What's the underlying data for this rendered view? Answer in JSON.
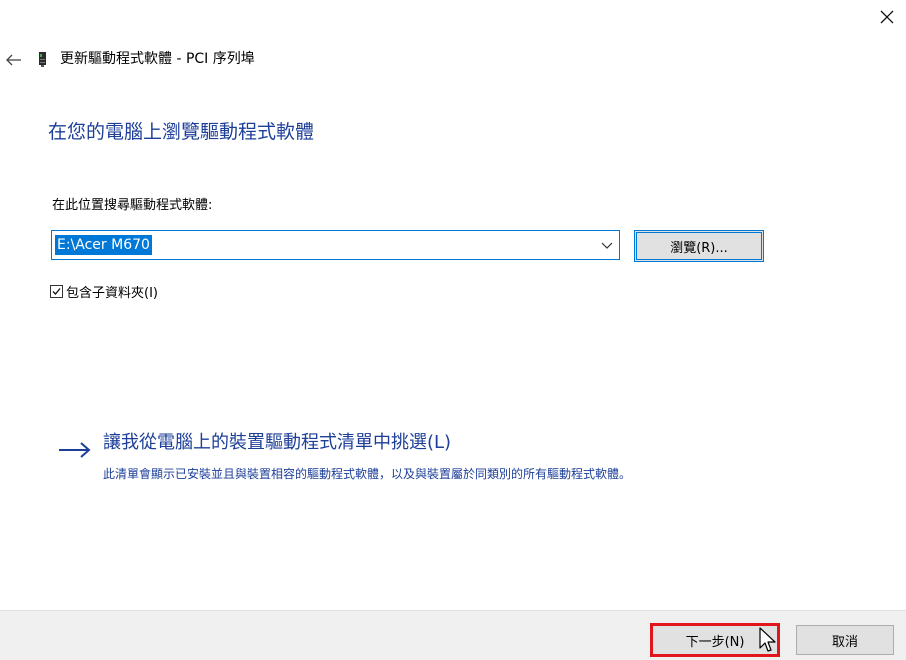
{
  "window": {
    "close_icon": "close-icon",
    "back_icon": "back-arrow-icon"
  },
  "header": {
    "device_icon": "pci-device-icon",
    "title": "更新驅動程式軟體 - PCI 序列埠"
  },
  "main": {
    "heading": "在您的電腦上瀏覽驅動程式軟體",
    "search_label": "在此位置搜尋驅動程式軟體:",
    "path_value": "E:\\Acer M670",
    "browse_label": "瀏覽(R)...",
    "include_subfolders_label": "包含子資料夾(I)",
    "include_subfolders_checked": true
  },
  "pick_option": {
    "arrow_icon": "right-arrow-icon",
    "link": "讓我從電腦上的裝置驅動程式清單中挑選(L)",
    "description": "此清單會顯示已安裝並且與裝置相容的驅動程式軟體，以及與裝置屬於同類別的所有驅動程式軟體。"
  },
  "footer": {
    "next_label": "下一步(N)",
    "cancel_label": "取消"
  },
  "colors": {
    "accent": "#0078d7",
    "link": "#1d3f99",
    "highlight_box": "#e0161a",
    "footer_bg": "#f0f0f0",
    "button_bg": "#e1e1e1"
  }
}
